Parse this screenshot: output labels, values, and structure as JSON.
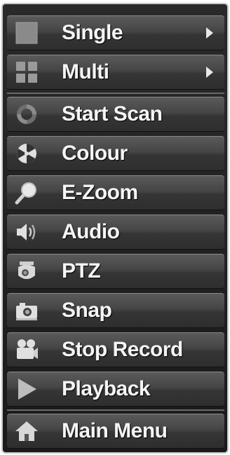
{
  "menu": {
    "items": [
      {
        "label": "Single",
        "icon": "single-square-icon",
        "has_submenu": true
      },
      {
        "label": "Multi",
        "icon": "grid-icon",
        "has_submenu": true
      },
      {
        "label": "Start Scan",
        "icon": "scan-cycle-icon",
        "has_submenu": false
      },
      {
        "label": "Colour",
        "icon": "color-palette-icon",
        "has_submenu": false
      },
      {
        "label": "E-Zoom",
        "icon": "magnifier-icon",
        "has_submenu": false
      },
      {
        "label": "Audio",
        "icon": "speaker-icon",
        "has_submenu": false
      },
      {
        "label": "PTZ",
        "icon": "ptz-camera-icon",
        "has_submenu": false
      },
      {
        "label": "Snap",
        "icon": "camera-icon",
        "has_submenu": false
      },
      {
        "label": "Stop Record",
        "icon": "video-camera-icon",
        "has_submenu": false
      },
      {
        "label": "Playback",
        "icon": "play-icon",
        "has_submenu": false
      },
      {
        "label": "Main Menu",
        "icon": "home-icon",
        "has_submenu": false
      }
    ]
  },
  "colors": {
    "background": "#1a1a1a",
    "item_gradient_top": "#5a5a5a",
    "item_gradient_bottom": "#2e2e2e",
    "text": "#f5f5f5"
  }
}
